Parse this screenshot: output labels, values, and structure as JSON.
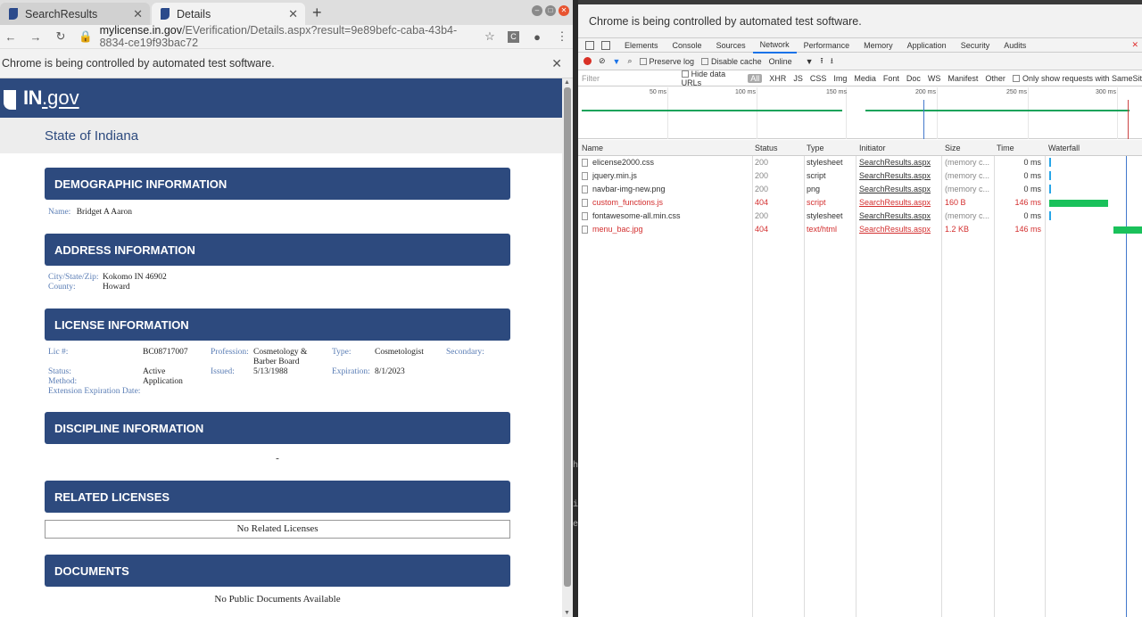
{
  "browser": {
    "tabs": [
      {
        "label": "SearchResults",
        "active": false
      },
      {
        "label": "Details",
        "active": true
      }
    ],
    "url_host": "mylicense.in.gov",
    "url_path": "/EVerification/Details.aspx?result=9e89befc-caba-43b4-8834-ce19f93bac72",
    "infobar_text": "Chrome is being controlled by automated test software."
  },
  "site": {
    "logo_in": "IN",
    "logo_gov": ".gov",
    "state_title": "State of Indiana"
  },
  "sections": {
    "demographic": "DEMOGRAPHIC INFORMATION",
    "address": "ADDRESS INFORMATION",
    "license": "LICENSE INFORMATION",
    "discipline": "DISCIPLINE INFORMATION",
    "related": "RELATED LICENSES",
    "documents": "DOCUMENTS"
  },
  "demographic": {
    "name_label": "Name:",
    "name_value": "Bridget A Aaron"
  },
  "address": {
    "csz_label": "City/State/Zip:",
    "csz_value": "Kokomo IN 46902",
    "county_label": "County:",
    "county_value": "Howard"
  },
  "license": {
    "lic_label": "Lic #:",
    "lic_value": "BC08717007",
    "profession_label": "Profession:",
    "profession_value_1": "Cosmetology &",
    "profession_value_2": "Barber Board",
    "type_label": "Type:",
    "type_value": "Cosmetologist",
    "secondary_label": "Secondary:",
    "status_label": "Status:",
    "status_value": "Active",
    "issued_label": "Issued:",
    "issued_value": "5/13/1988",
    "expiration_label": "Expiration:",
    "expiration_value": "8/1/2023",
    "method_label": "Method:",
    "method_value": "Application",
    "ext_label": "Extension Expiration Date:"
  },
  "discipline": {
    "value": "-"
  },
  "related": {
    "value": "No Related Licenses"
  },
  "documents": {
    "value": "No Public Documents Available"
  },
  "devtools": {
    "infobar_text": "Chrome is being controlled by automated test software.",
    "tabs": [
      "Elements",
      "Console",
      "Sources",
      "Network",
      "Performance",
      "Memory",
      "Application",
      "Security",
      "Audits"
    ],
    "active_tab": "Network",
    "controls": {
      "preserve_log": "Preserve log",
      "disable_cache": "Disable cache",
      "throttle": "Online",
      "throttle_arrow": "▼"
    },
    "filter": {
      "placeholder": "Filter",
      "hide_data_urls": "Hide data URLs",
      "types": [
        "All",
        "XHR",
        "JS",
        "CSS",
        "Img",
        "Media",
        "Font",
        "Doc",
        "WS",
        "Manifest",
        "Other"
      ],
      "samesite": "Only show requests with SameSit"
    },
    "ticks": [
      "50 ms",
      "100 ms",
      "150 ms",
      "200 ms",
      "250 ms",
      "300 ms"
    ],
    "columns": [
      "Name",
      "Status",
      "Type",
      "Initiator",
      "Size",
      "Time",
      "Waterfall"
    ],
    "rows": [
      {
        "name": "elicense2000.css",
        "status": "200",
        "type": "stylesheet",
        "initiator": "SearchResults.aspx",
        "size": "(memory c...",
        "time": "0 ms",
        "error": false
      },
      {
        "name": "jquery.min.js",
        "status": "200",
        "type": "script",
        "initiator": "SearchResults.aspx",
        "size": "(memory c...",
        "time": "0 ms",
        "error": false
      },
      {
        "name": "navbar-img-new.png",
        "status": "200",
        "type": "png",
        "initiator": "SearchResults.aspx",
        "size": "(memory c...",
        "time": "0 ms",
        "error": false
      },
      {
        "name": "custom_functions.js",
        "status": "404",
        "type": "script",
        "initiator": "SearchResults.aspx",
        "size": "160 B",
        "time": "146 ms",
        "error": true
      },
      {
        "name": "fontawesome-all.min.css",
        "status": "200",
        "type": "stylesheet",
        "initiator": "SearchResults.aspx",
        "size": "(memory c...",
        "time": "0 ms",
        "error": false
      },
      {
        "name": "menu_bac.jpg",
        "status": "404",
        "type": "text/html",
        "initiator": "SearchResults.aspx",
        "size": "1.2 KB",
        "time": "146 ms",
        "error": true
      }
    ]
  },
  "colors": {
    "brand": "#2d4a7e",
    "label": "#5a7db5",
    "error": "#d32f2f",
    "accent": "#1a73e8"
  }
}
